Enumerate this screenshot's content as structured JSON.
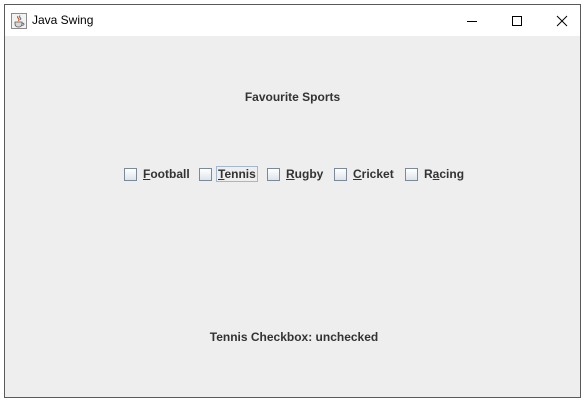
{
  "window": {
    "title": "Java Swing",
    "icon": "java-cup-icon",
    "controls": [
      "minimize-icon",
      "maximize-icon",
      "close-icon"
    ]
  },
  "heading": "Favourite Sports",
  "checkboxes": [
    {
      "label": "Football",
      "mnemonic_index": 0,
      "checked": false,
      "focused": false
    },
    {
      "label": "Tennis",
      "mnemonic_index": 0,
      "checked": false,
      "focused": true
    },
    {
      "label": "Rugby",
      "mnemonic_index": 0,
      "checked": false,
      "focused": false
    },
    {
      "label": "Cricket",
      "mnemonic_index": 0,
      "checked": false,
      "focused": false
    },
    {
      "label": "Racing",
      "mnemonic_index": 1,
      "checked": false,
      "focused": false
    }
  ],
  "status": {
    "text": "Tennis Checkbox: unchecked"
  },
  "colors": {
    "background": "#eeeeee",
    "titlebar": "#ffffff",
    "text": "#333333"
  }
}
